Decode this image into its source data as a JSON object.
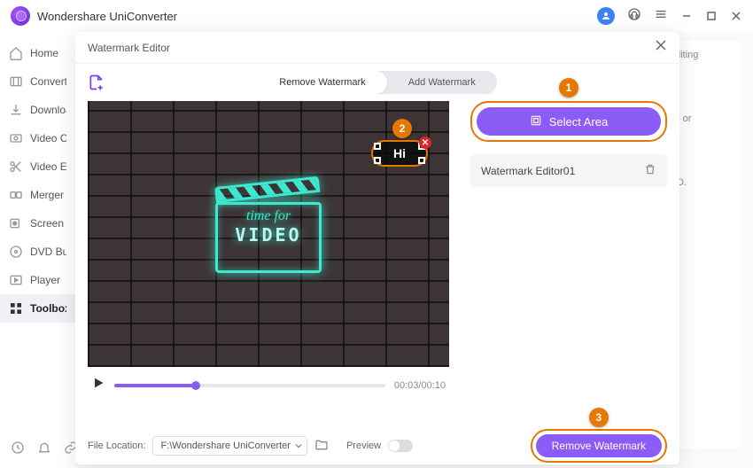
{
  "app": {
    "title": "Wondershare UniConverter"
  },
  "sidebar": {
    "items": [
      {
        "label": "Home"
      },
      {
        "label": "Converter"
      },
      {
        "label": "Downloader"
      },
      {
        "label": "Video Compressor"
      },
      {
        "label": "Video Editor"
      },
      {
        "label": "Merger"
      },
      {
        "label": "Screen Recorder"
      },
      {
        "label": "DVD Burner"
      },
      {
        "label": "Player"
      },
      {
        "label": "Toolbox"
      }
    ]
  },
  "bg": {
    "hint1": "editing",
    "hint2": "ps or",
    "hint3": "CD."
  },
  "modal": {
    "title": "Watermark Editor",
    "tabs": {
      "remove": "Remove Watermark",
      "add": "Add Watermark"
    },
    "selection": {
      "text": "Hi"
    },
    "neon": {
      "line1": "time for",
      "line2": "VIDEO"
    },
    "time": "00:03/00:10",
    "select_area_label": "Select Area",
    "wm_item": "Watermark Editor01",
    "footer": {
      "file_location_label": "File Location:",
      "file_location_value": "F:\\Wondershare UniConverter",
      "preview_label": "Preview",
      "remove_label": "Remove Watermark"
    }
  },
  "annot": {
    "n1": "1",
    "n2": "2",
    "n3": "3"
  }
}
